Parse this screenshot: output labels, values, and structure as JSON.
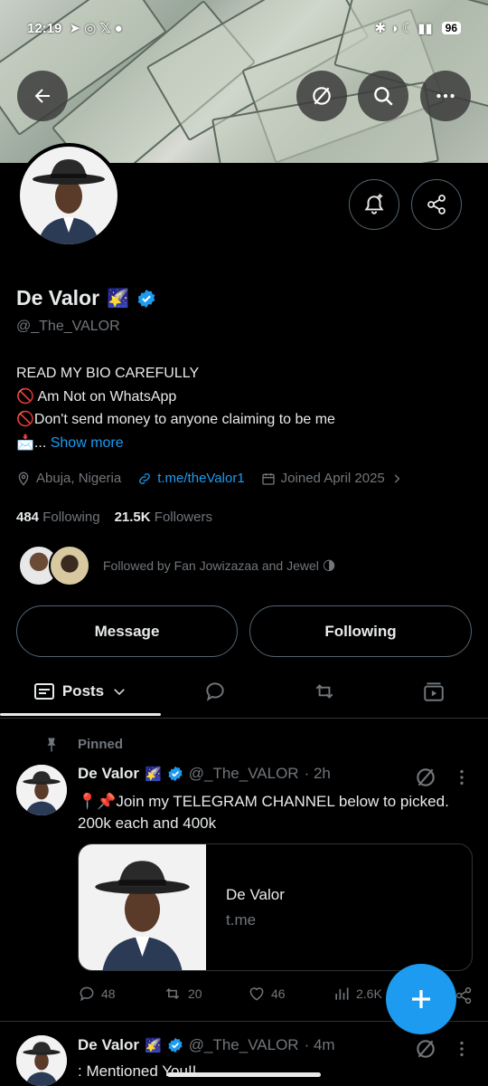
{
  "status_bar": {
    "time": "12:19",
    "battery": "96"
  },
  "profile": {
    "name": "De Valor",
    "handle": "@_The_VALOR",
    "bio_lines": [
      "READ MY BIO CAREFULLY",
      "🚫 Am Not on WhatsApp",
      "🚫Don't send money to anyone claiming to be me",
      "📩..."
    ],
    "show_more": "Show more",
    "location": "Abuja, Nigeria",
    "link": "t.me/theValor1",
    "joined": "Joined April 2025",
    "following_count": "484",
    "following_label": "Following",
    "followers_count": "21.5K",
    "followers_label": "Followers",
    "followed_by": "Followed by Fan Jowizazaa and Jewel 🌗"
  },
  "buttons": {
    "message": "Message",
    "following": "Following"
  },
  "tabs": {
    "posts": "Posts"
  },
  "posts": [
    {
      "pinned_label": "Pinned",
      "author": "De Valor",
      "handle": "@_The_VALOR",
      "time": "· 2h",
      "text_line1": "📍📌Join my TELEGRAM CHANNEL below to picked.",
      "text_line2": "200k each and 400k",
      "card_title": "De Valor",
      "card_domain": "t.me",
      "replies": "48",
      "reposts": "20",
      "likes": "46",
      "views": "2.6K"
    },
    {
      "author": "De Valor",
      "handle": "@_The_VALOR",
      "time": "· 4m",
      "text_line1": ": Mentioned You!!"
    }
  ],
  "colors": {
    "accent": "#1d9bf0",
    "background": "#000000",
    "muted": "#71767b",
    "text": "#e7e9ea",
    "border": "#2f3336"
  }
}
